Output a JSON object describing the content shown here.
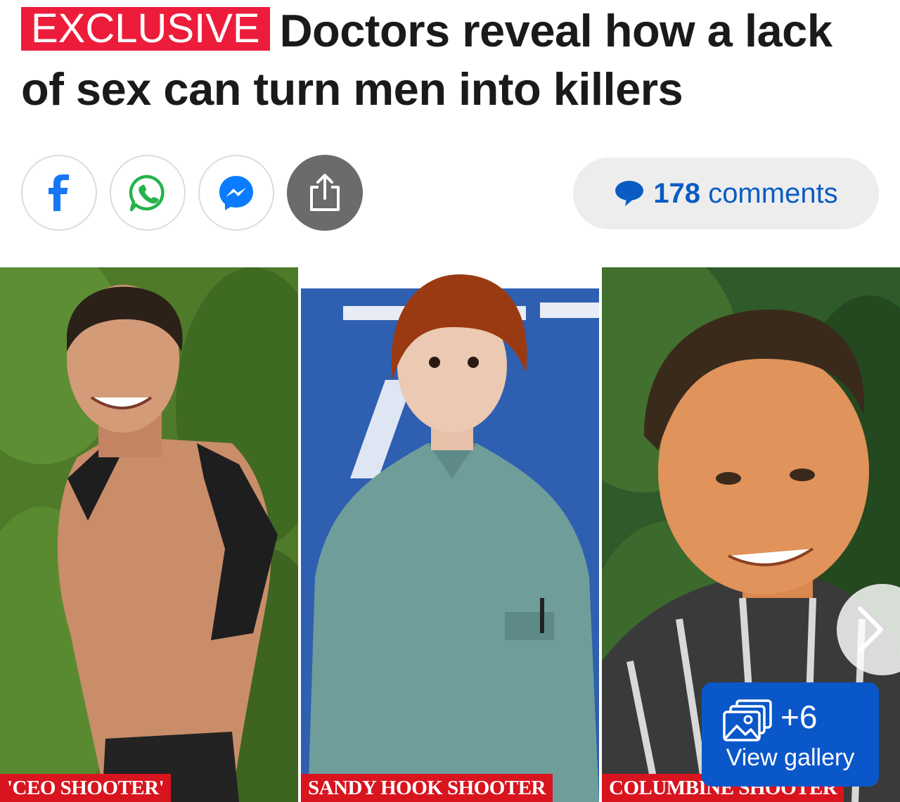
{
  "article": {
    "badge": "EXCLUSIVE",
    "headline": "Doctors reveal how a lack of sex can turn men into killers"
  },
  "share": {
    "facebook_icon": "facebook-icon",
    "whatsapp_icon": "whatsapp-icon",
    "messenger_icon": "messenger-icon",
    "share_icon": "share-icon"
  },
  "comments": {
    "count": "178",
    "label": "comments",
    "icon": "speech-bubble-icon",
    "color": "#0a5cc2"
  },
  "gallery": {
    "images": [
      {
        "caption": "'CEO SHOOTER'"
      },
      {
        "caption": "SANDY HOOK SHOOTER"
      },
      {
        "caption": "COLUMBINE SHOOTER"
      }
    ],
    "more_count": "+6",
    "view_label": "View gallery",
    "next_icon": "chevron-right-icon"
  },
  "colors": {
    "badge": "#ed1c3a",
    "caption": "#d8141f",
    "gallery_button": "#0a57c9"
  }
}
